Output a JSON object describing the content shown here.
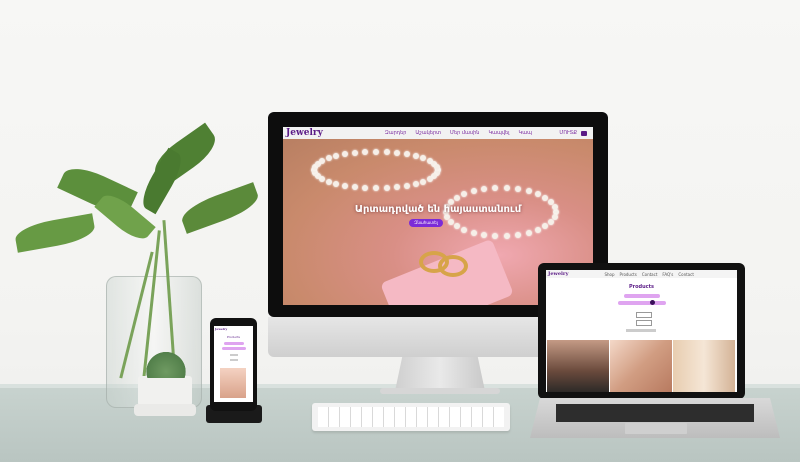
{
  "imac": {
    "logo": "Jewelry",
    "nav_links": [
      "Զարդեր",
      "Աշակերտ",
      "Մեր մասին",
      "Կապվել",
      "Կապ"
    ],
    "nav_right": "ՄՈՒՏՔ",
    "hero_title": "Արտադրված են հայաստանում",
    "hero_button": "Զնահատել"
  },
  "macbook": {
    "logo": "Jewelry",
    "nav_links": [
      "Shop",
      "Products",
      "Contact",
      "FAQ's",
      "Contact"
    ],
    "heading": "Products"
  },
  "phone": {
    "logo": "Jewelry",
    "heading": "Products"
  },
  "colors": {
    "brand": "#5a1a86",
    "accent_button": "#7b2bd8",
    "pill": "#dfa4f0"
  }
}
